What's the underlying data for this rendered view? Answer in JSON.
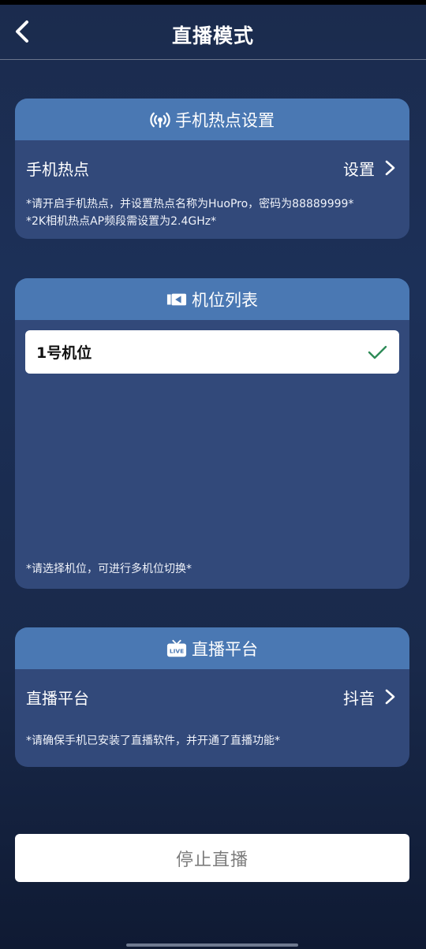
{
  "header": {
    "title": "直播模式",
    "back_icon": "chevron-left-icon"
  },
  "hotspot": {
    "title": "手机热点设置",
    "icon": "wifi-hotspot-icon",
    "row_label": "手机热点",
    "row_action": "设置",
    "note_line1": "*请开启手机热点，并设置热点名称为HuoPro，密码为88889999*",
    "note_line2": "*2K相机热点AP频段需设置为2.4GHz*"
  },
  "camera": {
    "title": "机位列表",
    "icon": "video-camera-icon",
    "items": [
      {
        "label": "1号机位",
        "selected": true
      }
    ],
    "note": "*请选择机位，可进行多机位切换*"
  },
  "platform": {
    "title": "直播平台",
    "icon": "live-tv-icon",
    "icon_text": "LIVE",
    "row_label": "直播平台",
    "row_value": "抖音",
    "note": "*请确保手机已安装了直播软件，并开通了直播功能*"
  },
  "stop_button": {
    "label": "停止直播"
  },
  "colors": {
    "card_header": "#4a78b3",
    "card_body": "#32497a",
    "check_green": "#2e8b57"
  }
}
